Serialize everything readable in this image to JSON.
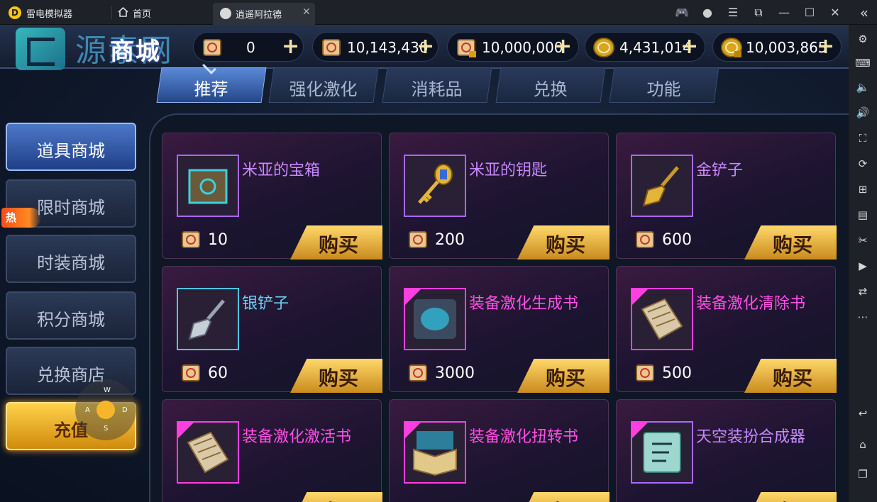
{
  "emulator": {
    "app_name": "雷电模拟器",
    "home_label": "首页",
    "active_tab": "逍遥阿拉德"
  },
  "game": {
    "shop_title": "商城",
    "watermark": "源素网",
    "currencies": [
      {
        "value": "0",
        "icon": "scroll-icon"
      },
      {
        "value": "10,143,430",
        "icon": "scroll-icon"
      },
      {
        "value": "10,000,000",
        "icon": "locked-scroll-icon"
      },
      {
        "value": "4,431,014",
        "icon": "gold-coin-icon"
      },
      {
        "value": "10,003,865",
        "icon": "locked-gold-coin-icon"
      }
    ],
    "category_tabs": [
      "推荐",
      "强化激化",
      "消耗品",
      "兑换",
      "功能"
    ],
    "left_nav": [
      "道具商城",
      "限时商城",
      "时装商城",
      "积分商城",
      "兑换商店",
      "充值"
    ],
    "hot_badge": "热",
    "wasd": {
      "w": "W",
      "a": "A",
      "s": "S",
      "d": "D"
    },
    "buy_label": "购买",
    "items": [
      {
        "name": "米亚的宝箱",
        "price": "10",
        "name_color": "#c889ff"
      },
      {
        "name": "米亚的钥匙",
        "price": "200",
        "name_color": "#c889ff"
      },
      {
        "name": "金铲子",
        "price": "600",
        "name_color": "#c889ff"
      },
      {
        "name": "银铲子",
        "price": "60",
        "name_color": "#69d3ee"
      },
      {
        "name": "装备激化生成书",
        "price": "3000",
        "name_color": "#ff4fe6"
      },
      {
        "name": "装备激化清除书",
        "price": "500",
        "name_color": "#ff4fe6"
      },
      {
        "name": "装备激化激活书",
        "price": "",
        "name_color": "#ff4fe6"
      },
      {
        "name": "装备激化扭转书",
        "price": "",
        "name_color": "#ff4fe6"
      },
      {
        "name": "天空装扮合成器",
        "price": "",
        "name_color": "#c889ff"
      }
    ]
  }
}
